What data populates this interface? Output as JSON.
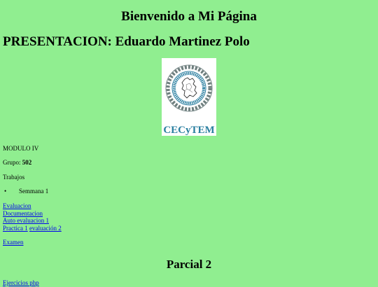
{
  "page": {
    "title": "Bienvenido a Mi Página",
    "presentation": "PRESENTACION: Eduardo Martinez Polo",
    "logo": {
      "icon": "cecytem-logo",
      "ring_text": "COLEGIO DE ESTUDIOS CIENTÍFICOS Y TECNOLÓGICOS DEL ESTADO DE MÉXICO",
      "name": "CECyTEM"
    },
    "modulo": "MODULO IV",
    "grupo_label": "Grupo:",
    "grupo_value": "502",
    "trabajos": "Trabajos",
    "list_items": [
      "Semmana 1"
    ],
    "links": {
      "evaluacion": "Evaluacion",
      "documentacion": "Documentacion",
      "auto_evaluacion": "Auto evaluacion 1",
      "practica": "Practica 1",
      "evaluacion2": "evaluación 2",
      "examen": "Examen"
    },
    "parcial": "Parcial 2",
    "bottom_link": "Ejercicios php"
  },
  "colors": {
    "background": "#90ee90",
    "link": "#0000ee",
    "logo_blue": "#2a7fa0"
  }
}
